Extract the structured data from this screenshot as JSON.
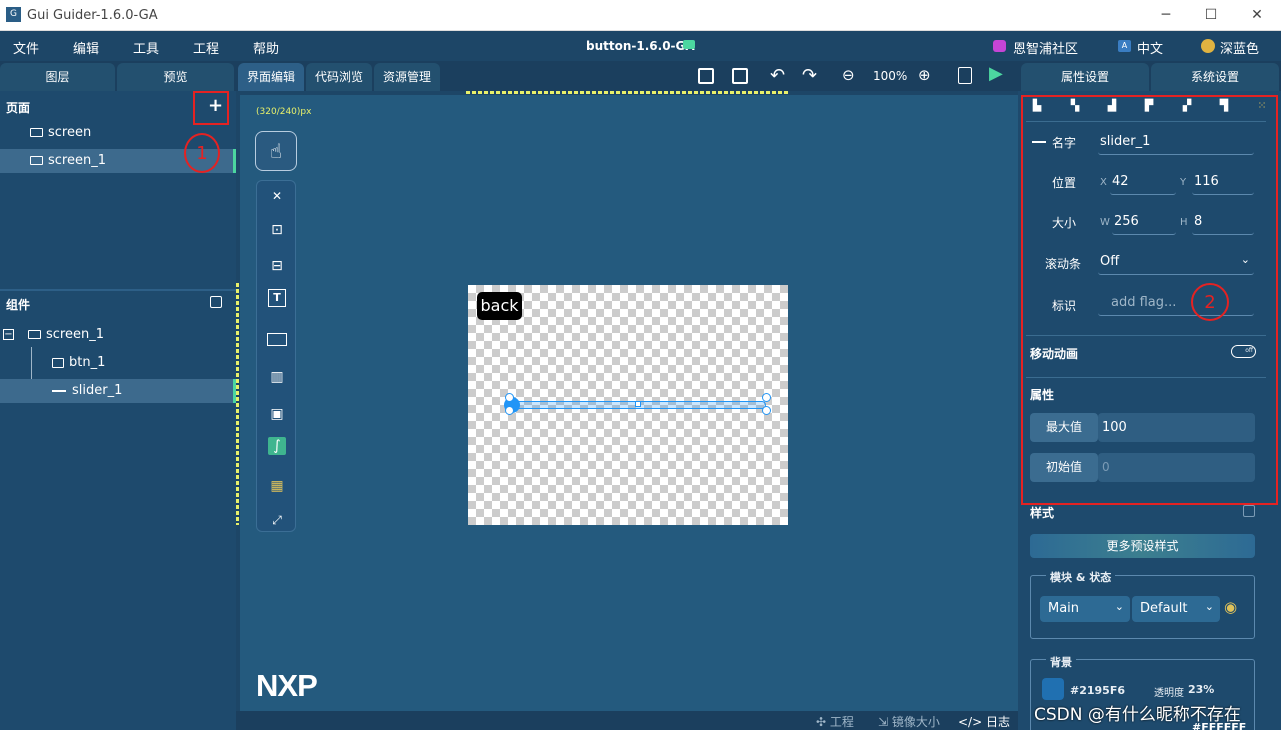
{
  "window": {
    "title": "Gui Guider-1.6.0-GA",
    "logo": "logo-icon",
    "minimize": "─",
    "maximize": "☐",
    "close": "✕"
  },
  "menubar": {
    "items": [
      "文件",
      "编辑",
      "工具",
      "工程",
      "帮助"
    ],
    "project_title": "button-1.6.0-GA",
    "community": "恩智浦社区",
    "language": "中文",
    "theme": "深蓝色"
  },
  "tabs": {
    "left": [
      "图层",
      "预览"
    ],
    "center": [
      "界面编辑",
      "代码浏览",
      "资源管理"
    ],
    "zoom": "100%",
    "right": [
      "属性设置",
      "系统设置"
    ]
  },
  "left_panel": {
    "pages_title": "页面",
    "add_btn": "+",
    "pages": [
      {
        "label": "screen"
      },
      {
        "label": "screen_1"
      }
    ],
    "components_title": "组件",
    "components": [
      {
        "label": "screen_1",
        "collapse": "−"
      },
      {
        "label": "btn_1"
      },
      {
        "label": "slider_1"
      }
    ],
    "annotation": "1"
  },
  "canvas": {
    "size_label": "(320/240)px",
    "back_label": "back",
    "brand": "NXP"
  },
  "statusbar": {
    "items": [
      "✣ 工程",
      "⇲ 镜像大小",
      "</> 日志"
    ]
  },
  "properties": {
    "name_label": "名字",
    "name_value": "slider_1",
    "pos_label": "位置",
    "x_label": "X",
    "x_value": "42",
    "y_label": "Y",
    "y_value": "116",
    "size_label": "大小",
    "w_label": "W",
    "w_value": "256",
    "h_label": "H",
    "h_value": "8",
    "scrollbar_label": "滚动条",
    "scrollbar_value": "Off",
    "flag_label": "标识",
    "flag_placeholder": "add flag...",
    "annotation": "2",
    "anim_label": "移动动画",
    "anim_toggle": "off",
    "attr_title": "属性",
    "max_label": "最大值",
    "max_value": "100",
    "init_label": "初始值",
    "init_value": "0",
    "style_title": "样式",
    "preset_btn": "更多预设样式",
    "module_state_title": "模块 & 状态",
    "module_value": "Main",
    "state_value": "Default",
    "bg_title": "背景",
    "bg_color": "#2195F6",
    "opacity_label": "透明度",
    "opacity_value": "23%",
    "bg_color2": "#FFFFFF"
  },
  "watermark": "CSDN @有什么昵称不存在"
}
